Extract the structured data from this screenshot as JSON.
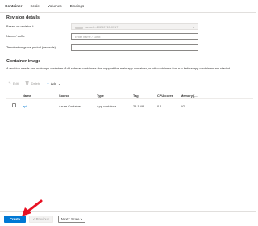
{
  "tabs": [
    {
      "label": "Container",
      "active": true
    },
    {
      "label": "Scale"
    },
    {
      "label": "Volumes"
    },
    {
      "label": "Bindings"
    }
  ],
  "revision_details": {
    "heading": "Revision details",
    "based_on_label": "Based on revision *",
    "based_on_value": "ca-web--20250715-0317",
    "name_label": "Name / suffix",
    "name_placeholder": "Enter name / suffix",
    "termination_label": "Termination grace period (seconds)"
  },
  "container_image": {
    "heading": "Container image",
    "description": "A revision needs one main app container. Add sidecar containers that support the main app container, or init containers that run before app containers are started."
  },
  "toolbar": {
    "edit_label": "Edit",
    "delete_label": "Delete",
    "add_label": "Add"
  },
  "table": {
    "columns": [
      "Name",
      "Source",
      "Type",
      "Tag",
      "CPU cores",
      "Memory (..."
    ],
    "rows": [
      {
        "name": "api",
        "source": "Azure Containe...",
        "type": "App container",
        "tag": "25.1.48",
        "cpu": "0.5",
        "memory": "1Gi"
      }
    ]
  },
  "footer": {
    "create_label": "Create",
    "previous_label": "< Previous",
    "next_label": "Next : Scale >"
  },
  "colors": {
    "accent": "#0078d4",
    "annotation_arrow": "#e81123"
  }
}
